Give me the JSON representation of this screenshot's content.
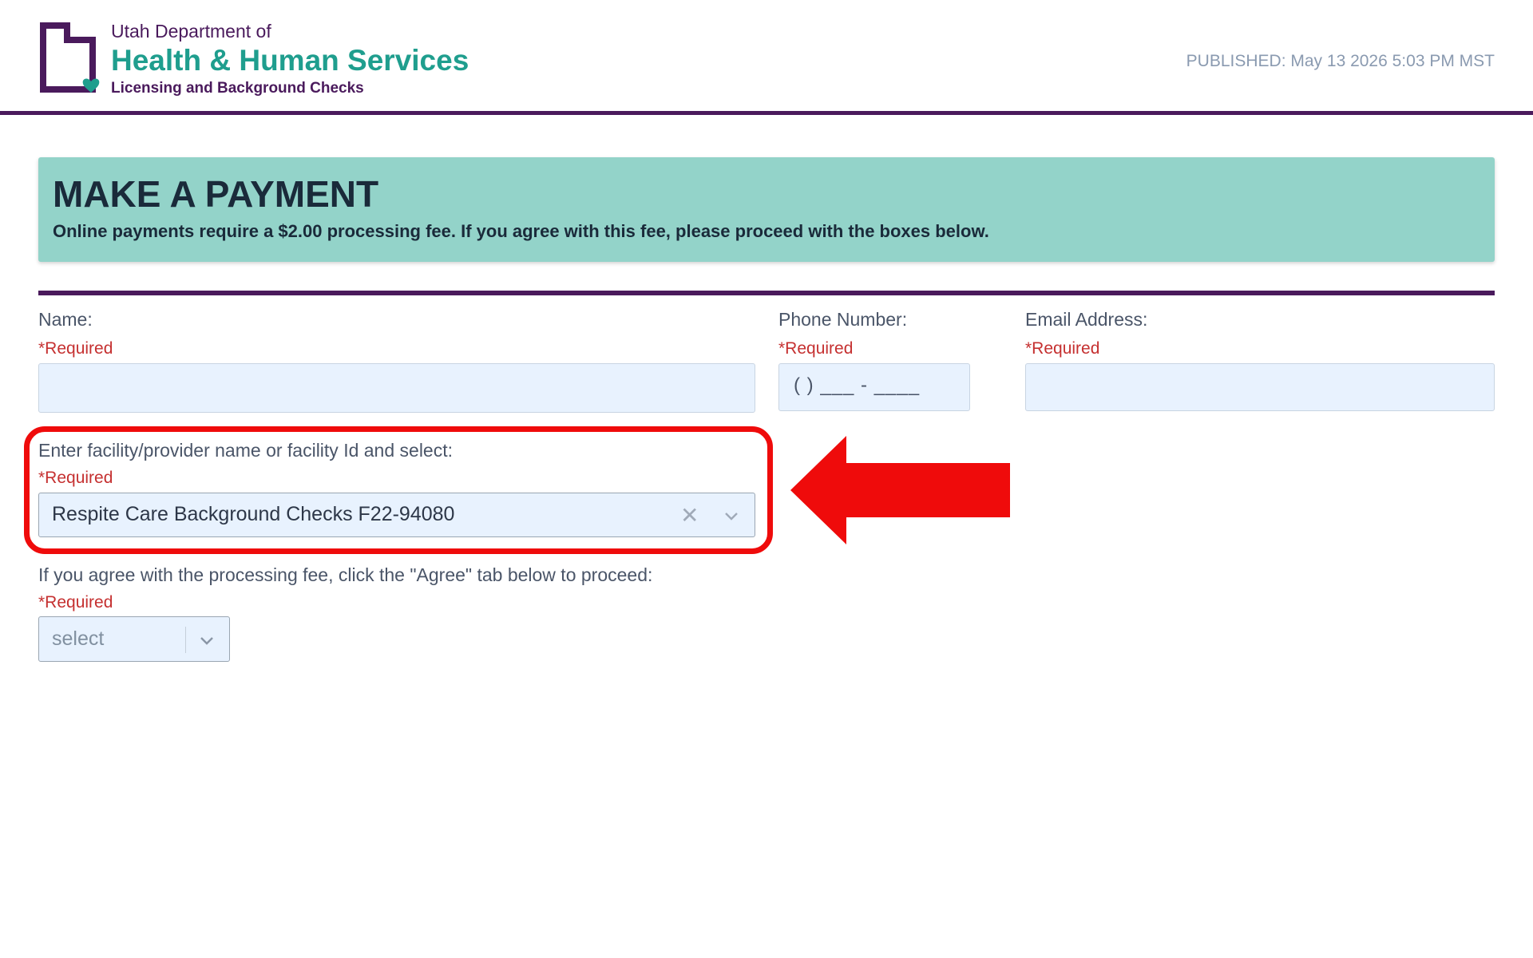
{
  "header": {
    "org_line1": "Utah Department of",
    "org_line2": "Health & Human Services",
    "org_line3": "Licensing and Background Checks",
    "published": "PUBLISHED: May 13 2026 5:03 PM MST",
    "logo_icon": "utah-state-outline-heart-icon",
    "colors": {
      "brand_purple": "#4a1a5c",
      "brand_teal": "#1f9e8e"
    }
  },
  "banner": {
    "title": "MAKE A PAYMENT",
    "subtitle": "Online payments require a $2.00 processing fee. If you agree with this fee, please proceed with the boxes below.",
    "background": "#93d3c9"
  },
  "form": {
    "required_text": "*Required",
    "name": {
      "label": "Name:",
      "value": ""
    },
    "phone": {
      "label": "Phone Number:",
      "mask": "(   ) ___ - ____"
    },
    "email": {
      "label": "Email Address:",
      "value": ""
    },
    "facility": {
      "label": "Enter facility/provider name or facility Id and select:",
      "selected": "Respite Care Background Checks F22-94080",
      "clear_symbol": "✕"
    },
    "agree": {
      "label": "If you agree with the processing fee, click the \"Agree\" tab below to proceed:",
      "placeholder": "select"
    }
  },
  "annotation": {
    "highlight_color": "#ef0b0b"
  }
}
